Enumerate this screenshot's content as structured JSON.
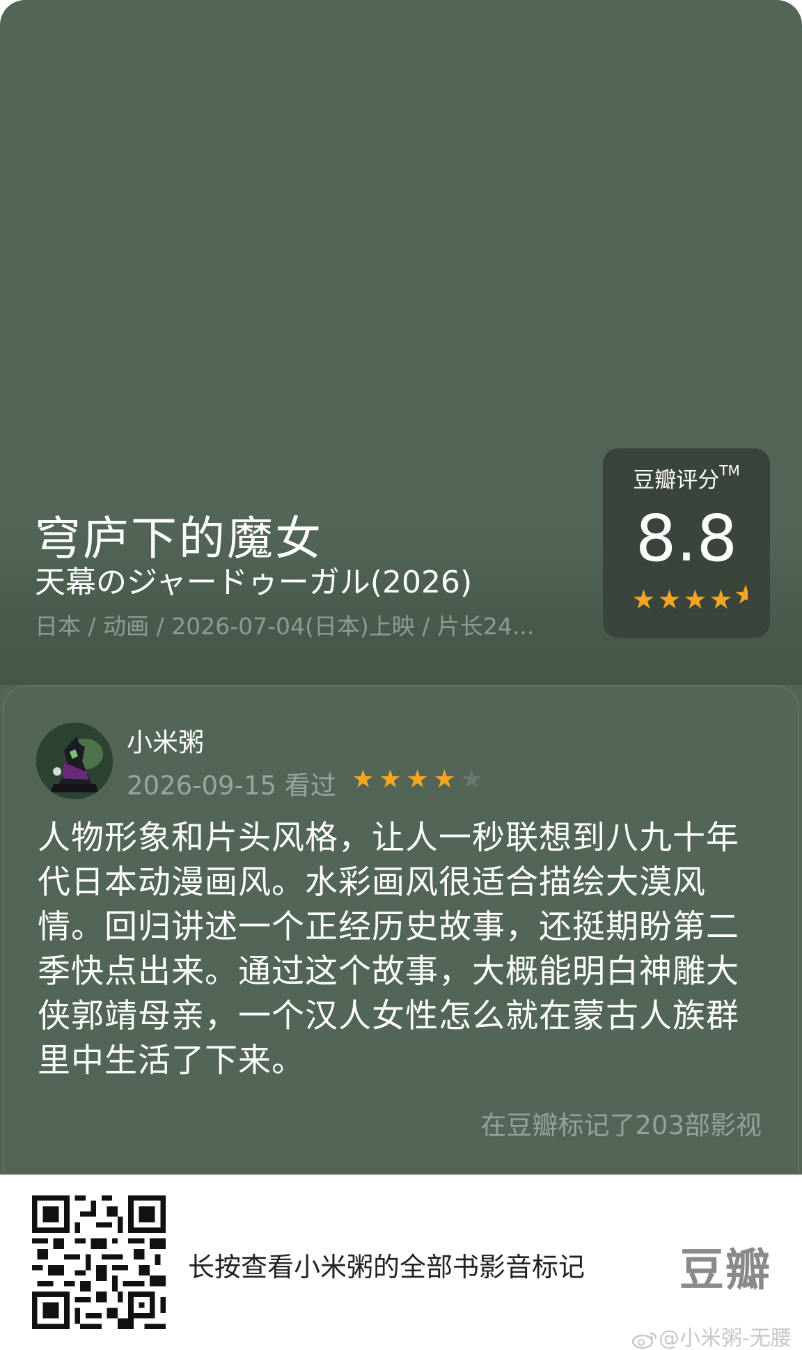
{
  "movie": {
    "title": "穹庐下的魔女",
    "original_title": "天幕のジャードゥーガル(2026)",
    "meta": "日本 / 动画 / 2026-07-04(日本)上映 / 片长24..."
  },
  "rating": {
    "label": "豆瓣评分",
    "trademark": "TM",
    "score": "8.8",
    "stars_value": 4.5,
    "stars_max": 5,
    "star_color": "#f5a623"
  },
  "review": {
    "user_name": "小米粥",
    "date_status": "2026-09-15 看过",
    "stars_value": 4,
    "stars_max": 5,
    "text": "人物形象和片头风格，让人一秒联想到八九十年代日本动漫画风。水彩画风很适合描绘大漠风情。回归讲述一个正经历史故事，还挺期盼第二季快点出来。通过这个故事，大概能明白神雕大侠郭靖母亲，一个汉人女性怎么就在蒙古人族群里中生活了下来。",
    "marked_count": "在豆瓣标记了203部影视"
  },
  "footer": {
    "prompt": "长按查看小米粥的全部书影音标记",
    "logo": "豆瓣",
    "qr_icon": "qr-code",
    "watermark": "@小米粥-无腰",
    "watermark_icon": "weibo-icon"
  },
  "colors": {
    "background": "#526556",
    "rating_box": "#39453b",
    "star": "#f5a623",
    "footer_bg": "#ffffff"
  }
}
